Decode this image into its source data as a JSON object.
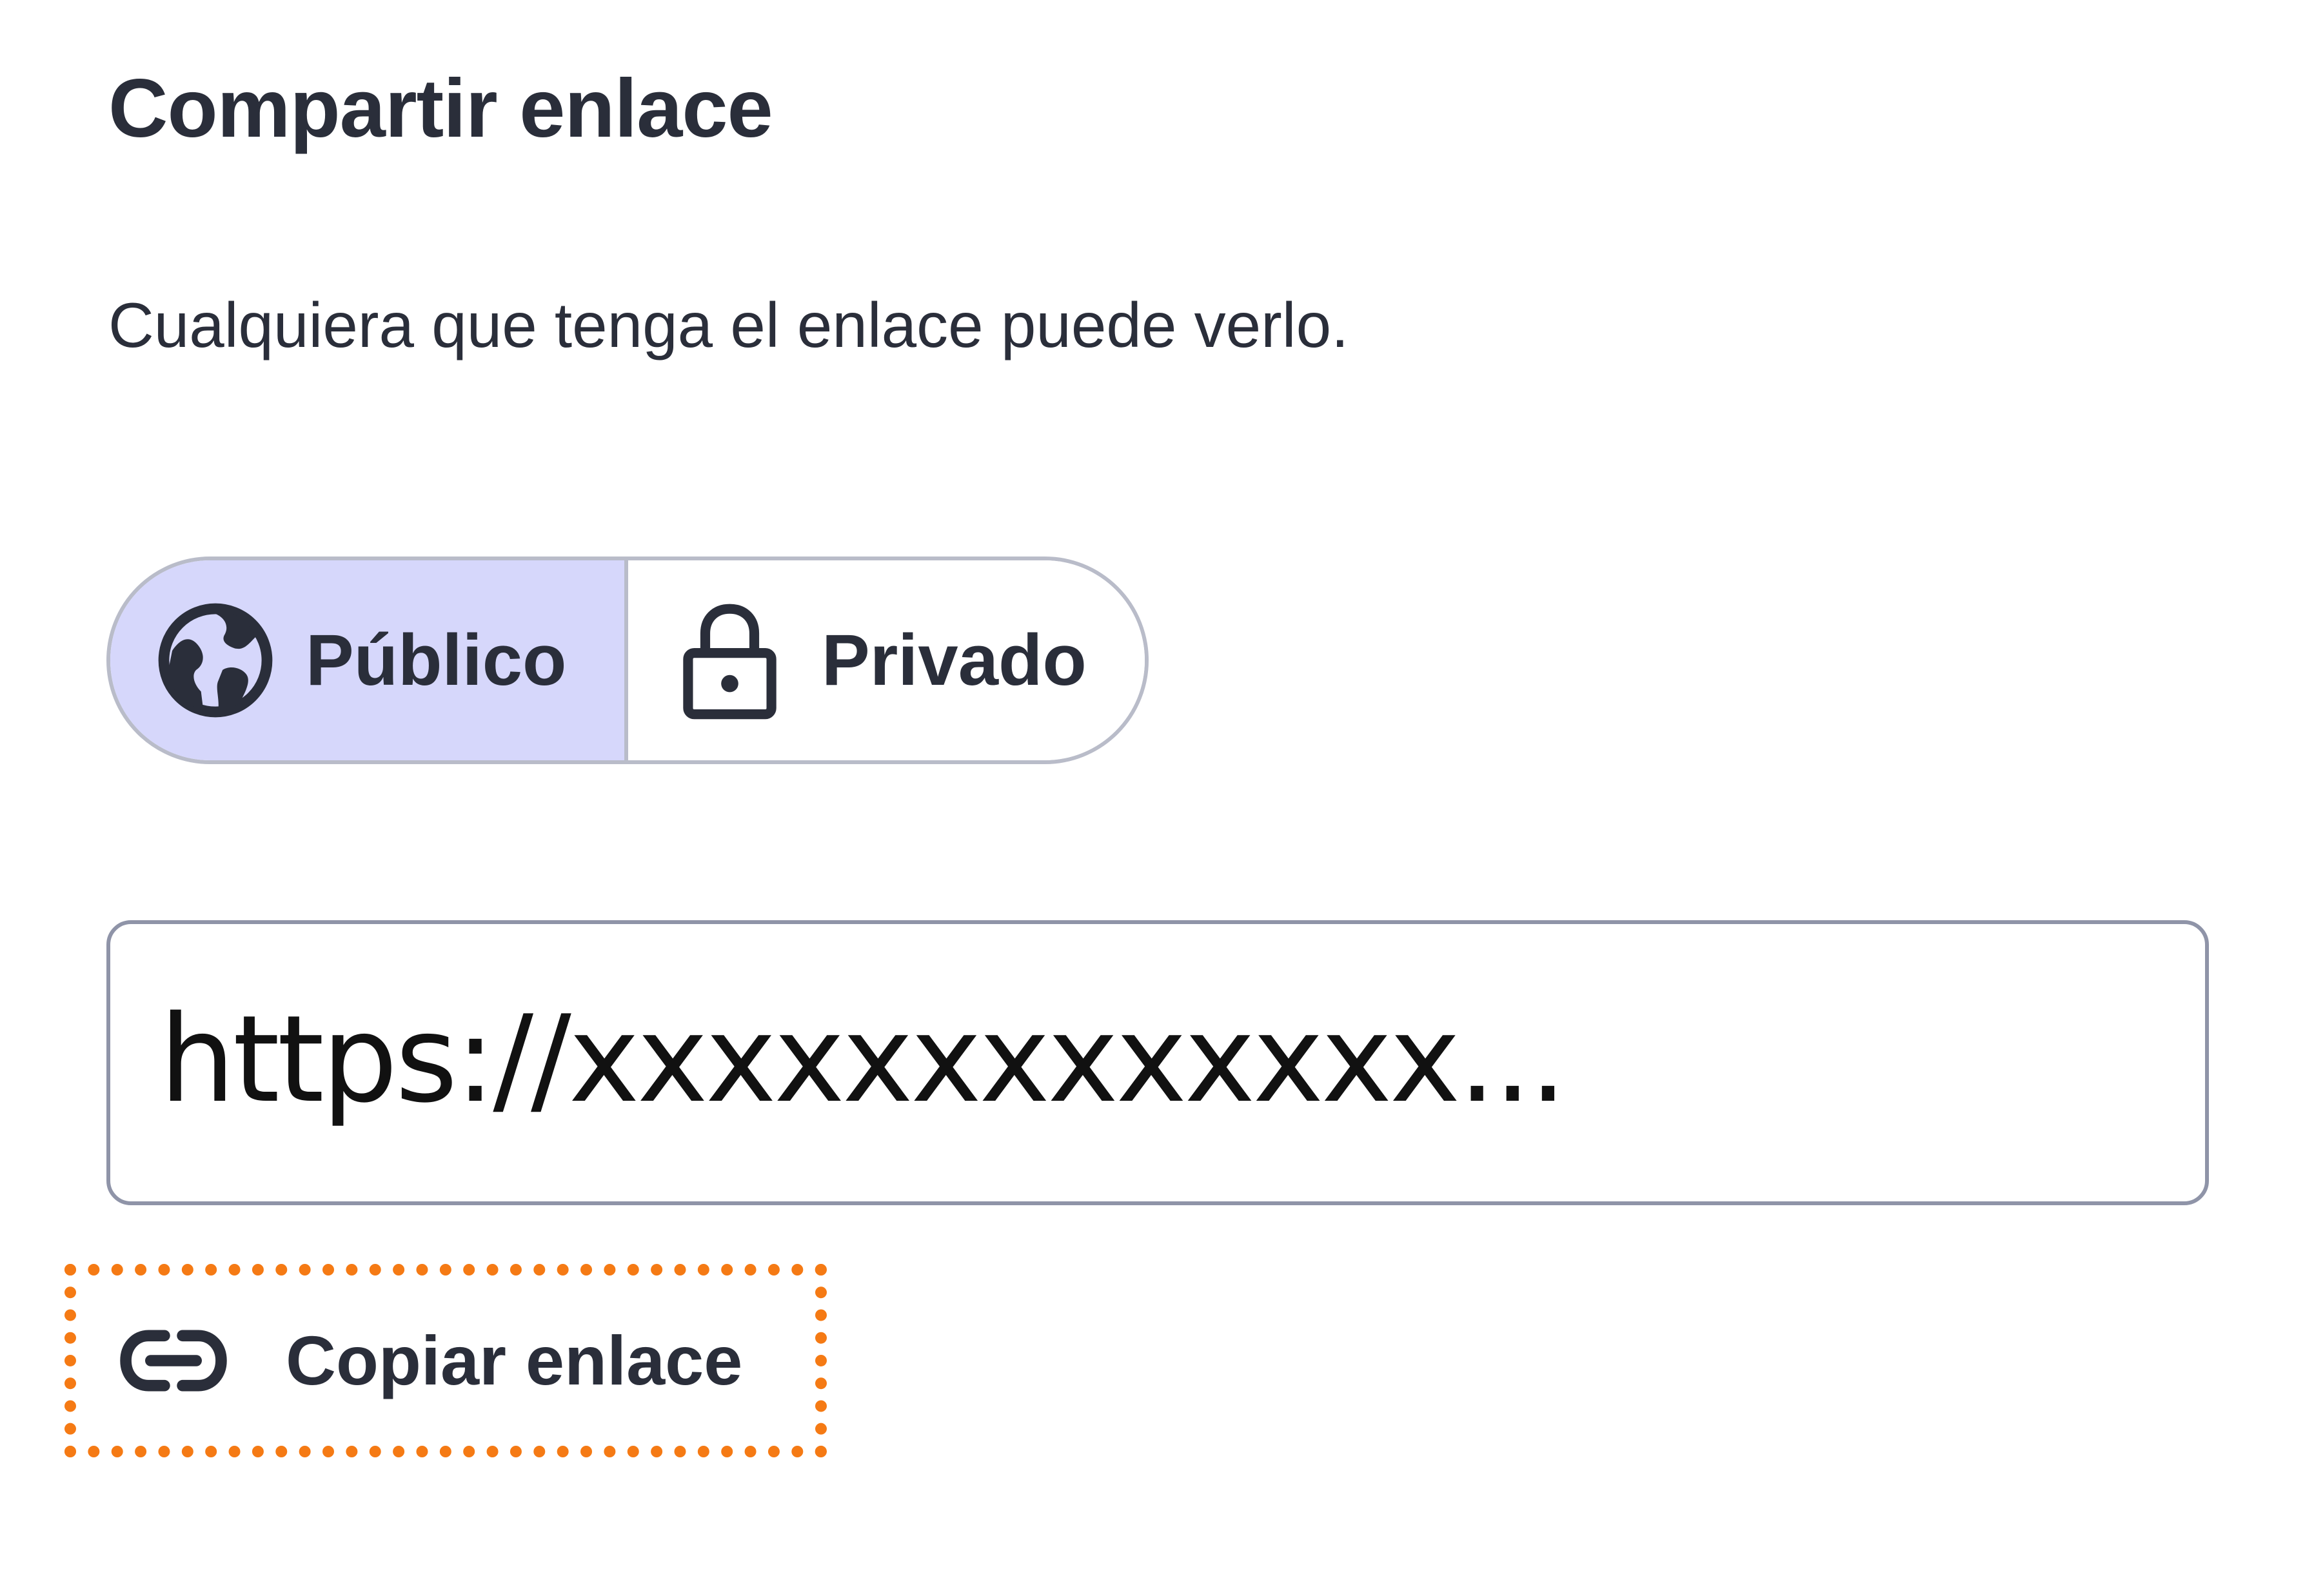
{
  "dialog": {
    "title": "Compartir enlace",
    "description": "Cualquiera que tenga el enlace puede verlo."
  },
  "visibility": {
    "selected": "public",
    "options": [
      {
        "id": "public",
        "label": "Público",
        "icon": "globe-icon"
      },
      {
        "id": "private",
        "label": "Privado",
        "icon": "lock-icon"
      }
    ]
  },
  "link": {
    "value": "https://xxxxxxxxxxxxx..."
  },
  "copy": {
    "label": "Copiar enlace",
    "icon": "link-icon"
  },
  "colors": {
    "text": "#2a2e3a",
    "selected_segment_bg": "#d6d7fb",
    "border": "#b9bcc9",
    "input_border": "#8f94a8",
    "focus_ring": "#f57a14"
  }
}
